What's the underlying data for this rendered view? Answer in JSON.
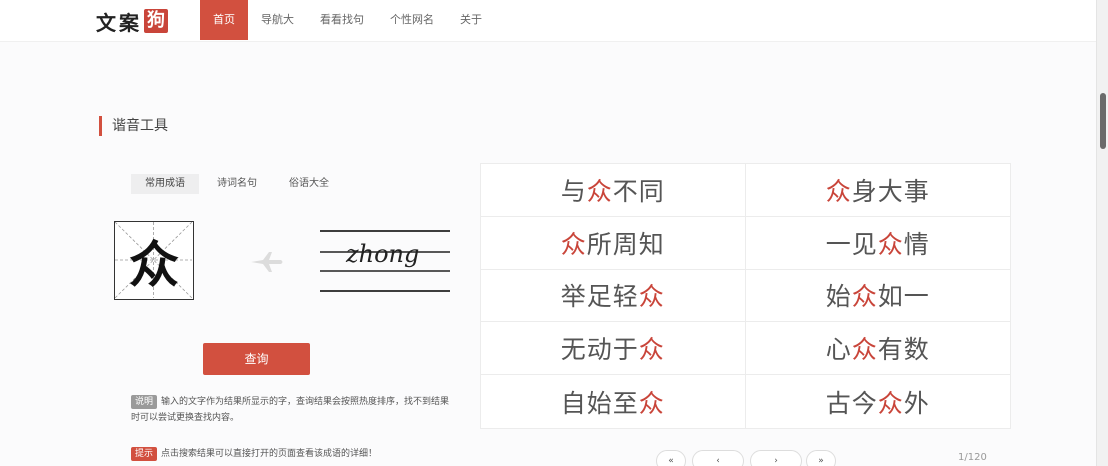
{
  "header": {
    "logo_text": "文案",
    "logo_mark": "狗",
    "nav": [
      {
        "label": "首页",
        "active": true
      },
      {
        "label": "导航大"
      },
      {
        "label": "看看找句"
      },
      {
        "label": "个性网名"
      },
      {
        "label": "关于"
      }
    ]
  },
  "section": {
    "title": "谐音工具"
  },
  "tabs": [
    {
      "label": "常用成语",
      "active": true
    },
    {
      "label": "诗词名句"
    },
    {
      "label": "俗语大全"
    }
  ],
  "converter": {
    "character": "众",
    "pinyin": "zhong"
  },
  "query_button": "查询",
  "notes": [
    {
      "badge": "说明",
      "text": "输入的文字作为结果所显示的字，查询结果会按照热度排序，找不到结果时可以尝试更换查找内容。"
    },
    {
      "badge": "提示",
      "text": "点击搜索结果可以直接打开的页面查看该成语的详细！"
    }
  ],
  "idioms": [
    {
      "pre": "与",
      "hl": "众",
      "post": "不同"
    },
    {
      "pre": "",
      "hl": "众",
      "post": "身大事"
    },
    {
      "pre": "",
      "hl": "众",
      "post": "所周知"
    },
    {
      "pre": "一见",
      "hl": "众",
      "post": "情"
    },
    {
      "pre": "举足轻",
      "hl": "众",
      "post": ""
    },
    {
      "pre": "始",
      "hl": "众",
      "post": "如一"
    },
    {
      "pre": "无动于",
      "hl": "众",
      "post": ""
    },
    {
      "pre": "心",
      "hl": "众",
      "post": "有数"
    },
    {
      "pre": "自始至",
      "hl": "众",
      "post": ""
    },
    {
      "pre": "古今",
      "hl": "众",
      "post": "外"
    }
  ],
  "pagination": {
    "first": "«",
    "prev": "‹",
    "next": "›",
    "last": "»",
    "page_count": "1/120"
  },
  "colors": {
    "accent": "#d2503f",
    "highlight": "#c9453a"
  }
}
